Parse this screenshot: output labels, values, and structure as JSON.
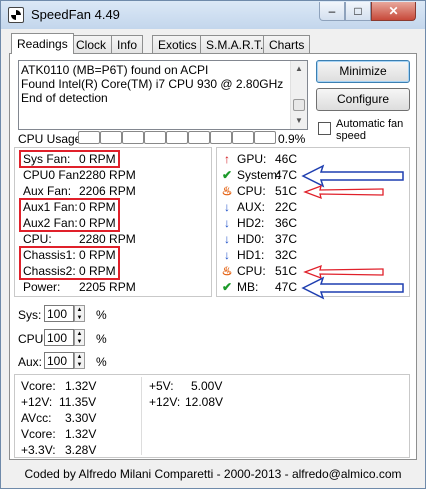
{
  "window": {
    "title": "SpeedFan 4.49",
    "minimize_glyph": "–",
    "maximize_glyph": "□",
    "close_glyph": "✕",
    "icon": "fan-icon"
  },
  "tabs": [
    {
      "label": "Readings",
      "active": true
    },
    {
      "label": "Clock",
      "active": false
    },
    {
      "label": "Info",
      "active": false
    },
    {
      "label": "Exotics",
      "active": false
    },
    {
      "label": "S.M.A.R.T.",
      "active": false
    },
    {
      "label": "Charts",
      "active": false
    }
  ],
  "log": [
    "ATK0110 (MB=P6T) found on ACPI",
    "Found Intel(R) Core(TM) i7 CPU 930 @ 2.80GHz",
    "End of detection"
  ],
  "buttons": {
    "minimize": "Minimize",
    "configure": "Configure"
  },
  "auto_fan": {
    "label": "Automatic fan speed",
    "checked": false
  },
  "cpu_usage": {
    "label": "CPU Usage",
    "value": "0.9%",
    "cells": 9
  },
  "fans": [
    {
      "label": "Sys Fan:",
      "value": "0 RPM"
    },
    {
      "label": "CPU0 Fan:",
      "value": "2280 RPM"
    },
    {
      "label": "Aux Fan:",
      "value": "2206 RPM"
    },
    {
      "label": "Aux1 Fan:",
      "value": "0 RPM"
    },
    {
      "label": "Aux2 Fan:",
      "value": "0 RPM"
    },
    {
      "label": "CPU:",
      "value": "2280 RPM"
    },
    {
      "label": "Chassis1:",
      "value": "0 RPM"
    },
    {
      "label": "Chassis2:",
      "value": "0 RPM"
    },
    {
      "label": "Power:",
      "value": "2205 RPM"
    }
  ],
  "temps": [
    {
      "icon": "arrow-up-icon",
      "label": "GPU:",
      "value": "46C"
    },
    {
      "icon": "checkmark-icon",
      "label": "System:",
      "value": "47C"
    },
    {
      "icon": "flame-icon",
      "label": "CPU:",
      "value": "51C"
    },
    {
      "icon": "arrow-down-icon",
      "label": "AUX:",
      "value": "22C"
    },
    {
      "icon": "arrow-down-icon",
      "label": "HD2:",
      "value": "36C"
    },
    {
      "icon": "arrow-down-icon",
      "label": "HD0:",
      "value": "37C"
    },
    {
      "icon": "arrow-down-icon",
      "label": "HD1:",
      "value": "32C"
    },
    {
      "icon": "flame-icon",
      "label": "CPU:",
      "value": "51C"
    },
    {
      "icon": "checkmark-icon",
      "label": "MB:",
      "value": "47C"
    }
  ],
  "speeds": [
    {
      "label": "Sys:",
      "value": "100",
      "unit": "%"
    },
    {
      "label": "CPU:",
      "value": "100",
      "unit": "%"
    },
    {
      "label": "Aux:",
      "value": "100",
      "unit": "%"
    }
  ],
  "voltages_left": [
    {
      "label": "Vcore:",
      "value": "1.32V"
    },
    {
      "label": "+12V:",
      "value": "11.35V"
    },
    {
      "label": "AVcc:",
      "value": "3.30V"
    },
    {
      "label": "Vcore:",
      "value": "1.32V"
    },
    {
      "label": "+3.3V:",
      "value": "3.28V"
    }
  ],
  "voltages_right": [
    {
      "label": "+5V:",
      "value": "5.00V"
    },
    {
      "label": "+12V:",
      "value": "12.08V"
    }
  ],
  "footer": "Coded by Alfredo Milani Comparetti - 2000-2013 - alfredo@almico.com",
  "colors": {
    "annotation_red": "#e0202a",
    "annotation_blue": "#1f3fb0"
  }
}
